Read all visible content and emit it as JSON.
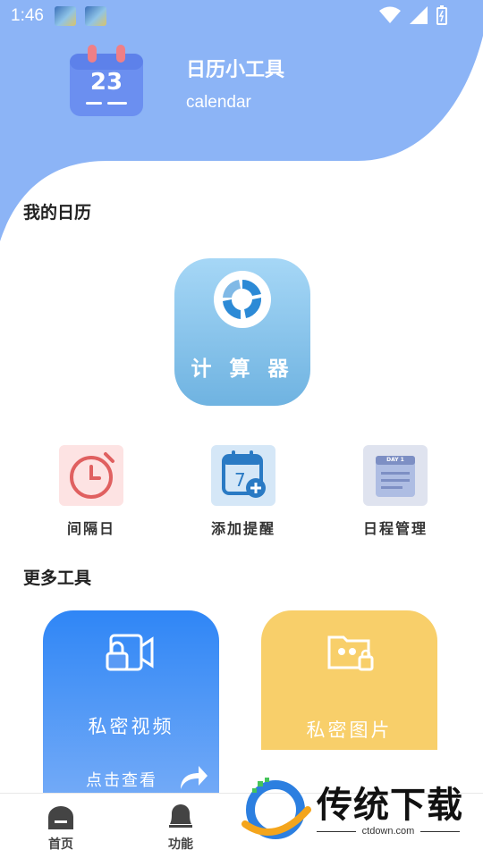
{
  "status_bar": {
    "time": "1:46"
  },
  "header": {
    "calendar_day": "23",
    "app_title": "日历小工具",
    "app_subtitle": "calendar"
  },
  "my_calendar": {
    "section_title": "我的日历",
    "calculator_label": "计 算 器"
  },
  "tools": [
    {
      "label": "间隔日",
      "icon": "clock-icon",
      "bg": "#fde3e3"
    },
    {
      "label": "添加提醒",
      "icon": "calendar-add-icon",
      "bg": "#d5e7f7"
    },
    {
      "label": "日程管理",
      "icon": "schedule-icon",
      "bg": "#dfe3ef",
      "badge": "DAY 1"
    }
  ],
  "more_tools": {
    "section_title": "更多工具",
    "cards": [
      {
        "title": "私密视频",
        "footer": "点击查看",
        "icon": "locked-video-icon"
      },
      {
        "title": "私密图片",
        "icon": "locked-folder-icon"
      }
    ]
  },
  "tabbar": {
    "items": [
      {
        "label": "首页",
        "icon": "home-icon"
      },
      {
        "label": "功能",
        "icon": "bell-icon"
      }
    ]
  },
  "watermark": {
    "brand": "传统下载",
    "url": "ctdown.com"
  },
  "colors": {
    "hero": "#8cb4f6",
    "calc_card_top": "#a6d7f6",
    "calc_card_bottom": "#6fb3e1",
    "video_card_top": "#2f86f6",
    "image_card": "#f8cf6a"
  }
}
